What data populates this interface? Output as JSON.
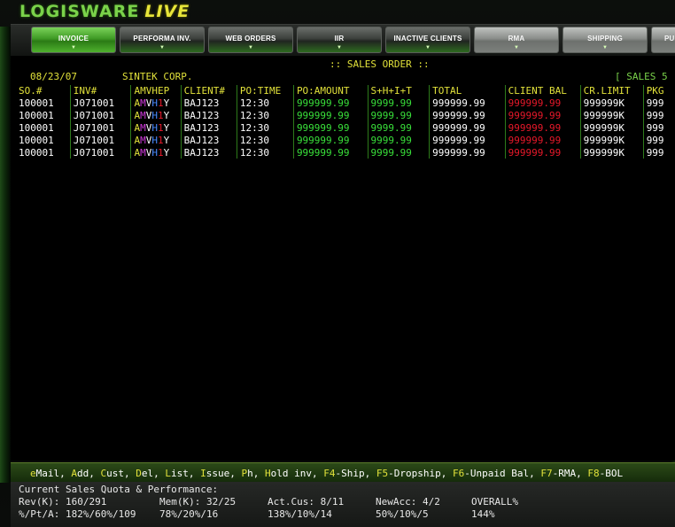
{
  "app": {
    "logo_part1": "LOGISWARE",
    "logo_part2": "LIVE"
  },
  "nav": [
    {
      "label": "INVOICE",
      "style": "green"
    },
    {
      "label": "PERFORMA INV.",
      "style": "dark"
    },
    {
      "label": "WEB ORDERS",
      "style": "dark"
    },
    {
      "label": "IIR",
      "style": "dark"
    },
    {
      "label": "INACTIVE CLIENTS",
      "style": "dark"
    },
    {
      "label": "RMA",
      "style": "grey"
    },
    {
      "label": "SHIPPING",
      "style": "grey"
    },
    {
      "label": "PU",
      "style": "grey"
    }
  ],
  "terminal": {
    "title": ":: SALES ORDER ::",
    "date": "08/23/07",
    "company": "SINTEK CORP.",
    "right_label": "[ SALES 5"
  },
  "table": {
    "headers": [
      "SO.#",
      "INV#",
      "AMVHEP",
      "CLIENT#",
      "PO:TIME",
      "PO:AMOUNT",
      "S+H+I+T",
      "TOTAL",
      "CLIENT BAL",
      "CR.LIMIT",
      "PKG"
    ],
    "rows": [
      {
        "so": "100001",
        "inv": "J071001",
        "amvhep": [
          "A",
          "M",
          "V",
          "H",
          "1",
          "Y"
        ],
        "client": "BAJ123",
        "potime": "12:30",
        "poamount": "999999.99",
        "shit": "9999.99",
        "total": "999999.99",
        "clientbal": "999999.99",
        "crlimit": "999999K",
        "pkg": "999"
      },
      {
        "so": "100001",
        "inv": "J071001",
        "amvhep": [
          "A",
          "M",
          "V",
          "H",
          "1",
          "Y"
        ],
        "client": "BAJ123",
        "potime": "12:30",
        "poamount": "999999.99",
        "shit": "9999.99",
        "total": "999999.99",
        "clientbal": "999999.99",
        "crlimit": "999999K",
        "pkg": "999"
      },
      {
        "so": "100001",
        "inv": "J071001",
        "amvhep": [
          "A",
          "M",
          "V",
          "H",
          "1",
          "Y"
        ],
        "client": "BAJ123",
        "potime": "12:30",
        "poamount": "999999.99",
        "shit": "9999.99",
        "total": "999999.99",
        "clientbal": "999999.99",
        "crlimit": "999999K",
        "pkg": "999"
      },
      {
        "so": "100001",
        "inv": "J071001",
        "amvhep": [
          "A",
          "M",
          "V",
          "H",
          "1",
          "Y"
        ],
        "client": "BAJ123",
        "potime": "12:30",
        "poamount": "999999.99",
        "shit": "9999.99",
        "total": "999999.99",
        "clientbal": "999999.99",
        "crlimit": "999999K",
        "pkg": "999"
      },
      {
        "so": "100001",
        "inv": "J071001",
        "amvhep": [
          "A",
          "M",
          "V",
          "H",
          "1",
          "Y"
        ],
        "client": "BAJ123",
        "potime": "12:30",
        "poamount": "999999.99",
        "shit": "9999.99",
        "total": "999999.99",
        "clientbal": "999999.99",
        "crlimit": "999999K",
        "pkg": "999"
      }
    ]
  },
  "fkeys": [
    {
      "key": "e",
      "rest": "Mail,"
    },
    {
      "key": "A",
      "rest": "dd,"
    },
    {
      "key": "C",
      "rest": "ust,"
    },
    {
      "key": "D",
      "rest": "el,"
    },
    {
      "key": "L",
      "rest": "ist,"
    },
    {
      "key": "I",
      "rest": "ssue,"
    },
    {
      "key": "P",
      "rest": "h,"
    },
    {
      "key": "H",
      "rest": "old inv,"
    },
    {
      "key": "F4",
      "rest": "-Ship,"
    },
    {
      "key": "F5",
      "rest": "-Dropship,"
    },
    {
      "key": "F6",
      "rest": "-Unpaid Bal,"
    },
    {
      "key": "F7",
      "rest": "-RMA,"
    },
    {
      "key": "F8",
      "rest": "-BOL"
    }
  ],
  "performance": {
    "title": "Current Sales Quota & Performance:",
    "row1": [
      "Rev(K): 160/291",
      "Mem(K): 32/25",
      "Act.Cus: 8/11",
      "NewAcc: 4/2",
      "OVERALL%"
    ],
    "row2": [
      "%/Pt/A: 182%/60%/109",
      "78%/20%/16",
      "138%/10%/14",
      "50%/10%/5",
      "144%"
    ]
  },
  "colors": {
    "accent_green": "#39e03a",
    "header_yellow": "#e1e13a",
    "alert_red": "#e8182a"
  }
}
